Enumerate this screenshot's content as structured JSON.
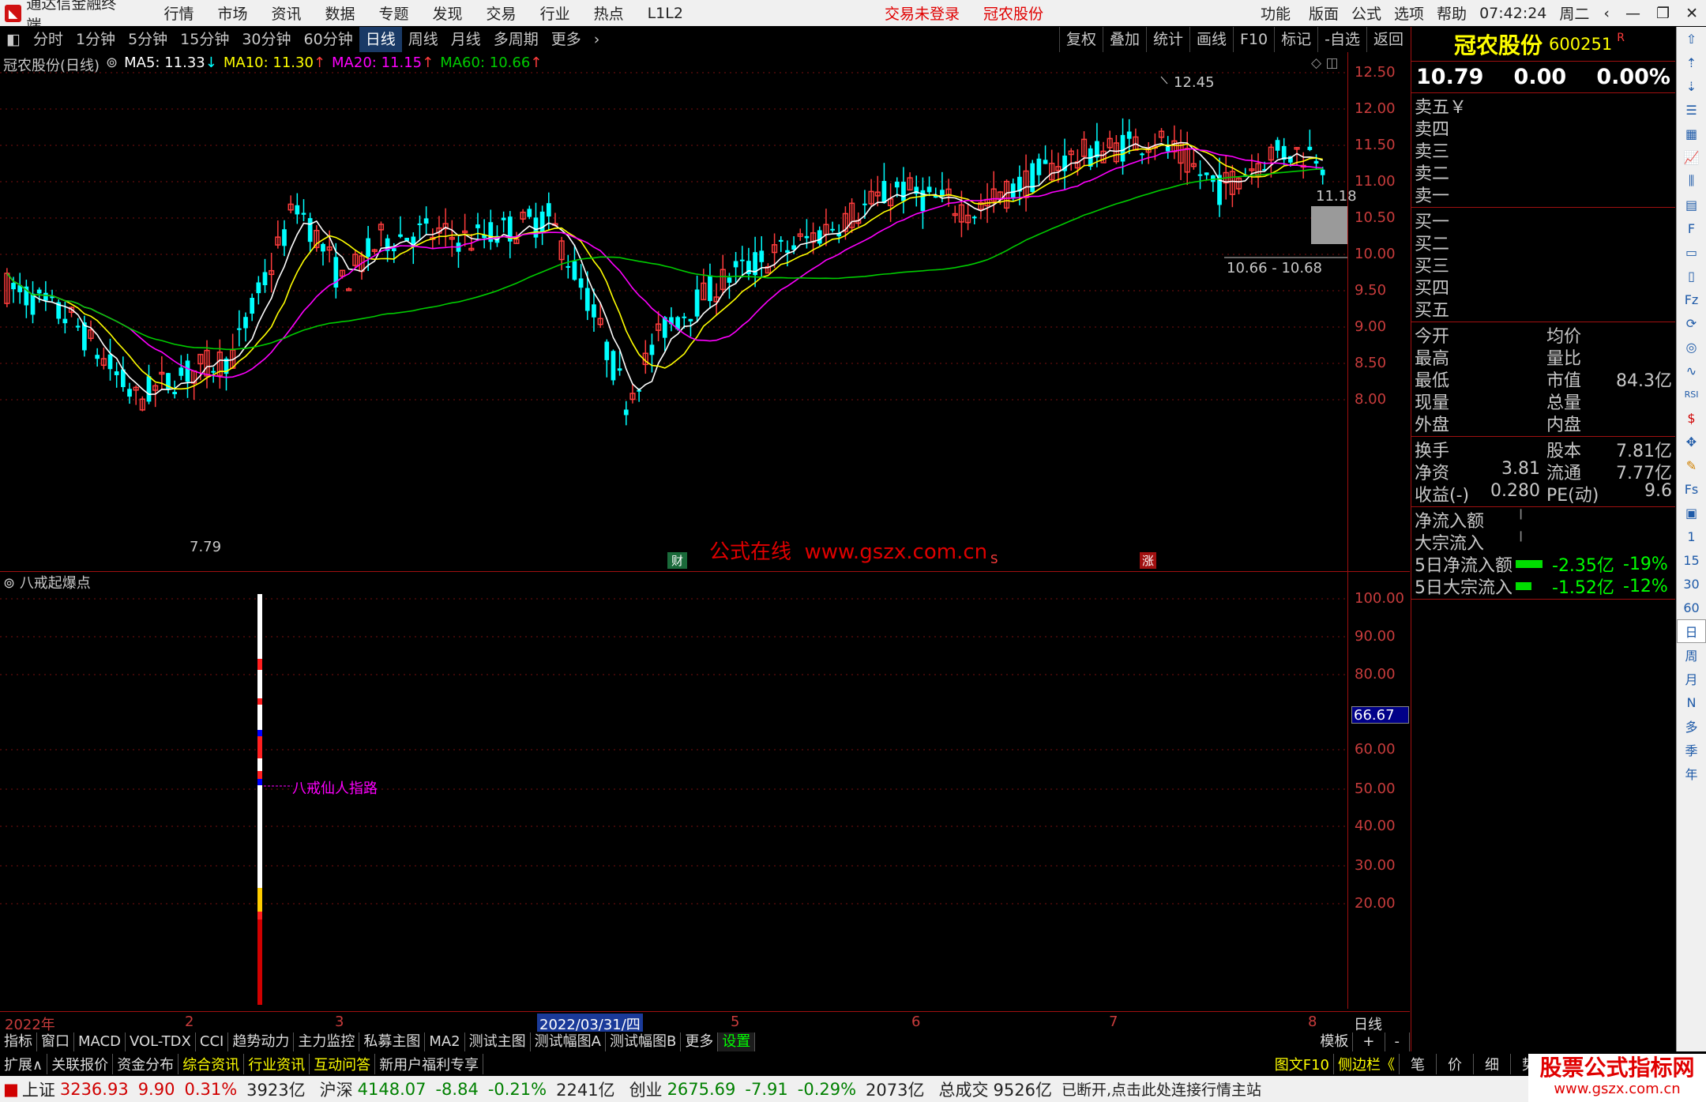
{
  "titlebar": {
    "app_name": "通达信金融终端",
    "menu": [
      "行情",
      "市场",
      "资讯",
      "数据",
      "专题",
      "发现",
      "交易",
      "行业",
      "热点",
      "L1L2"
    ],
    "trade_status": "交易未登录",
    "stock_name": "冠农股份",
    "right_menu": [
      "功能",
      "版面",
      "公式",
      "选项",
      "帮助"
    ],
    "time": "07:42:24",
    "weekday": "周二"
  },
  "periods": [
    "分时",
    "1分钟",
    "5分钟",
    "15分钟",
    "30分钟",
    "60分钟",
    "日线",
    "周线",
    "月线",
    "多周期",
    "更多"
  ],
  "active_period": "日线",
  "tools": [
    "复权",
    "叠加",
    "统计",
    "画线",
    "F10",
    "标记",
    "-自选",
    "返回"
  ],
  "ma_header": {
    "label": "冠农股份(日线)",
    "ma5": "MA5: 11.33",
    "ma10": "MA10: 11.30",
    "ma20": "MA20: 11.15",
    "ma60": "MA60: 10.66"
  },
  "price_axis": [
    "12.50",
    "12.00",
    "11.50",
    "11.00",
    "10.50",
    "10.00",
    "9.50",
    "9.00",
    "8.50",
    "8.00"
  ],
  "chart_annotations": {
    "high": "12.45",
    "low": "7.79",
    "last": "11.18",
    "range": "10.66 - 10.68",
    "watermark": "公式在线  www.gszx.com.cn",
    "mark_cai": "财",
    "mark_s": "S",
    "mark_zhang": "涨"
  },
  "indicator": {
    "title": "八戒起爆点",
    "line_label": "八戒仙人指路",
    "axis": [
      "100.00",
      "90.00",
      "80.00",
      "60.00",
      "50.00",
      "40.00",
      "30.00",
      "20.00"
    ],
    "current_value": "66.67"
  },
  "xaxis": [
    "2022年",
    "2",
    "3",
    "2022/03/31/四",
    "5",
    "6",
    "7",
    "8",
    "日线"
  ],
  "tabs": [
    "指标",
    "窗口",
    "MACD",
    "VOL-TDX",
    "CCI",
    "趋势动力",
    "主力监控",
    "私募主图",
    "MA2",
    "测试主图",
    "测试幅图A",
    "测试幅图B",
    "更多",
    "设置"
  ],
  "tabs_right": [
    "模板",
    "+",
    "-"
  ],
  "lowbar": [
    "扩展∧",
    "关联报价",
    "资金分布",
    "综合资讯",
    "行业资讯",
    "互动问答",
    "新用户福利专享"
  ],
  "lowbar_right": [
    "图文F10",
    "侧边栏《",
    "笔",
    "价",
    "细",
    "势"
  ],
  "quote": {
    "name": "冠农股份",
    "code": "600251",
    "price": "10.79",
    "change": "0.00",
    "pct": "0.00%",
    "sell": [
      "卖五",
      "卖四",
      "卖三",
      "卖二",
      "卖一"
    ],
    "buy": [
      "买一",
      "买二",
      "买三",
      "买四",
      "买五"
    ],
    "currency": "￥",
    "stats": [
      {
        "l": "今开",
        "lv": "",
        "r": "均价",
        "rv": ""
      },
      {
        "l": "最高",
        "lv": "",
        "r": "量比",
        "rv": ""
      },
      {
        "l": "最低",
        "lv": "",
        "r": "市值",
        "rv": "84.3亿"
      },
      {
        "l": "现量",
        "lv": "",
        "r": "总量",
        "rv": ""
      },
      {
        "l": "外盘",
        "lv": "",
        "r": "内盘",
        "rv": ""
      }
    ],
    "stats2": [
      {
        "l": "换手",
        "lv": "",
        "r": "股本",
        "rv": "7.81亿"
      },
      {
        "l": "净资",
        "lv": "3.81",
        "r": "流通",
        "rv": "7.77亿"
      },
      {
        "l": "收益(-)",
        "lv": "0.280",
        "r": "PE(动)",
        "rv": "9.6"
      }
    ],
    "flows": [
      {
        "l": "净流入额",
        "v": "",
        "p": ""
      },
      {
        "l": "大宗流入",
        "v": "",
        "p": ""
      },
      {
        "l": "5日净流入额",
        "v": "-2.35亿",
        "p": "-19%"
      },
      {
        "l": "5日大宗流入",
        "v": "-1.52亿",
        "p": "-12%"
      }
    ]
  },
  "side_nums": [
    "1",
    "15",
    "30",
    "60",
    "日",
    "周",
    "月",
    "N",
    "多",
    "季",
    "年"
  ],
  "status": {
    "sh_name": "上证",
    "sh_val": "3236.93",
    "sh_chg": "9.90",
    "sh_pct": "0.31%",
    "sh_amt": "3923亿",
    "hs_name": "沪深",
    "hs_val": "4148.07",
    "hs_chg": "-8.84",
    "hs_pct": "-0.21%",
    "hs_amt": "2241亿",
    "cy_name": "创业",
    "cy_val": "2675.69",
    "cy_chg": "-7.91",
    "cy_pct": "-0.29%",
    "cy_amt": "2073亿",
    "total_label": "总成交",
    "total_val": "9526亿",
    "msg": "已断开,点击此处连接行情主站",
    "brand": "股票公式指标网",
    "brand_url": "www.gszx.com.cn"
  },
  "colors": {
    "up": "#ff3c3c",
    "down": "#00ffff",
    "ma5": "#ffffff",
    "ma10": "#ffff00",
    "ma20": "#ff00ff",
    "ma60": "#00cc00",
    "grid": "#a01010"
  }
}
